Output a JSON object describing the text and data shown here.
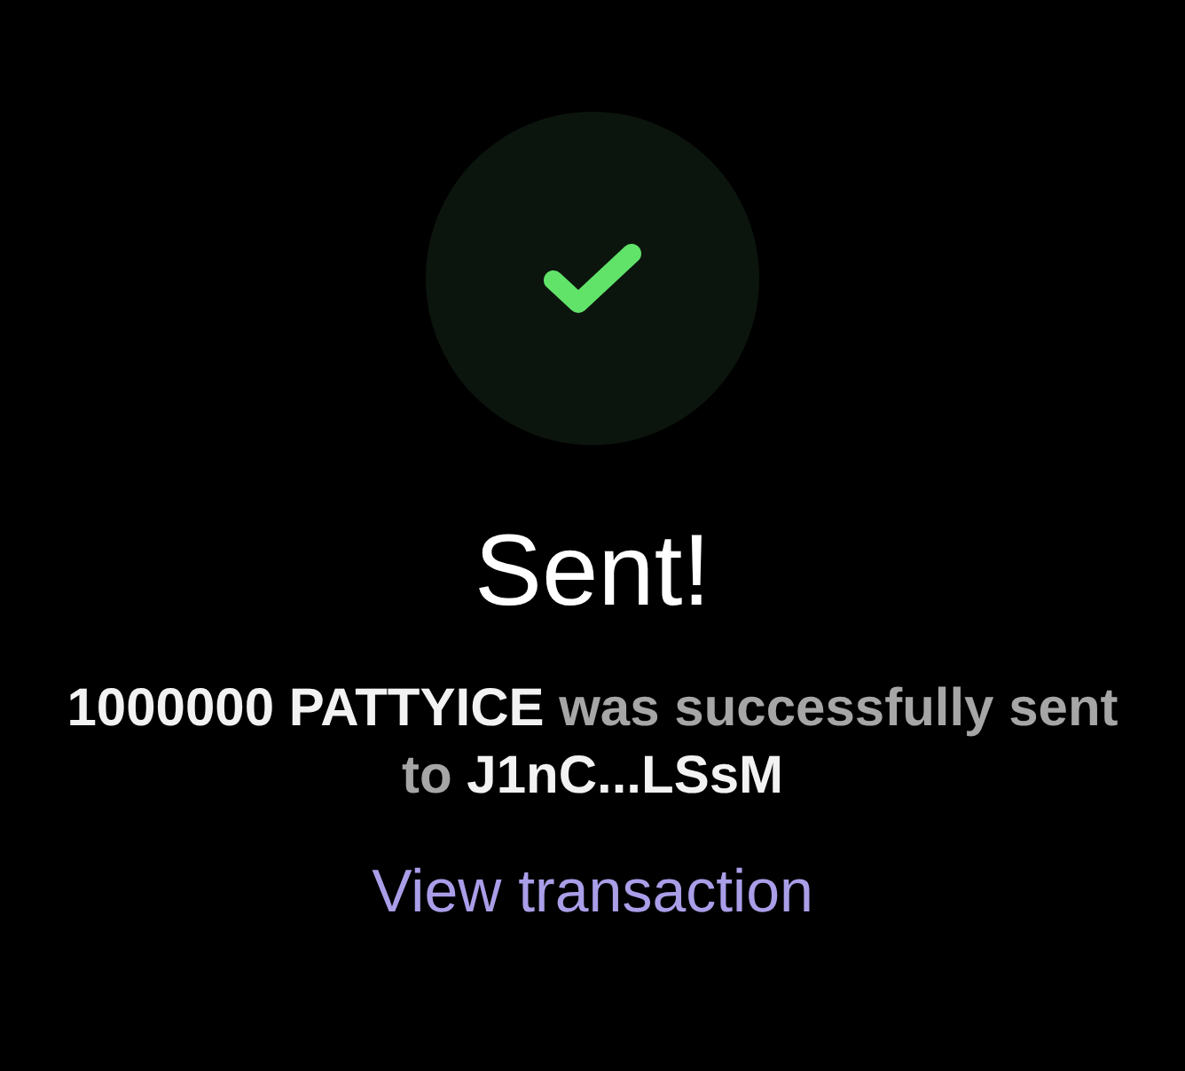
{
  "title": "Sent!",
  "message": "**1000000 PATTYICE** was successfully sent to **J1nC...LSsM**",
  "link": "View transaction"
}
